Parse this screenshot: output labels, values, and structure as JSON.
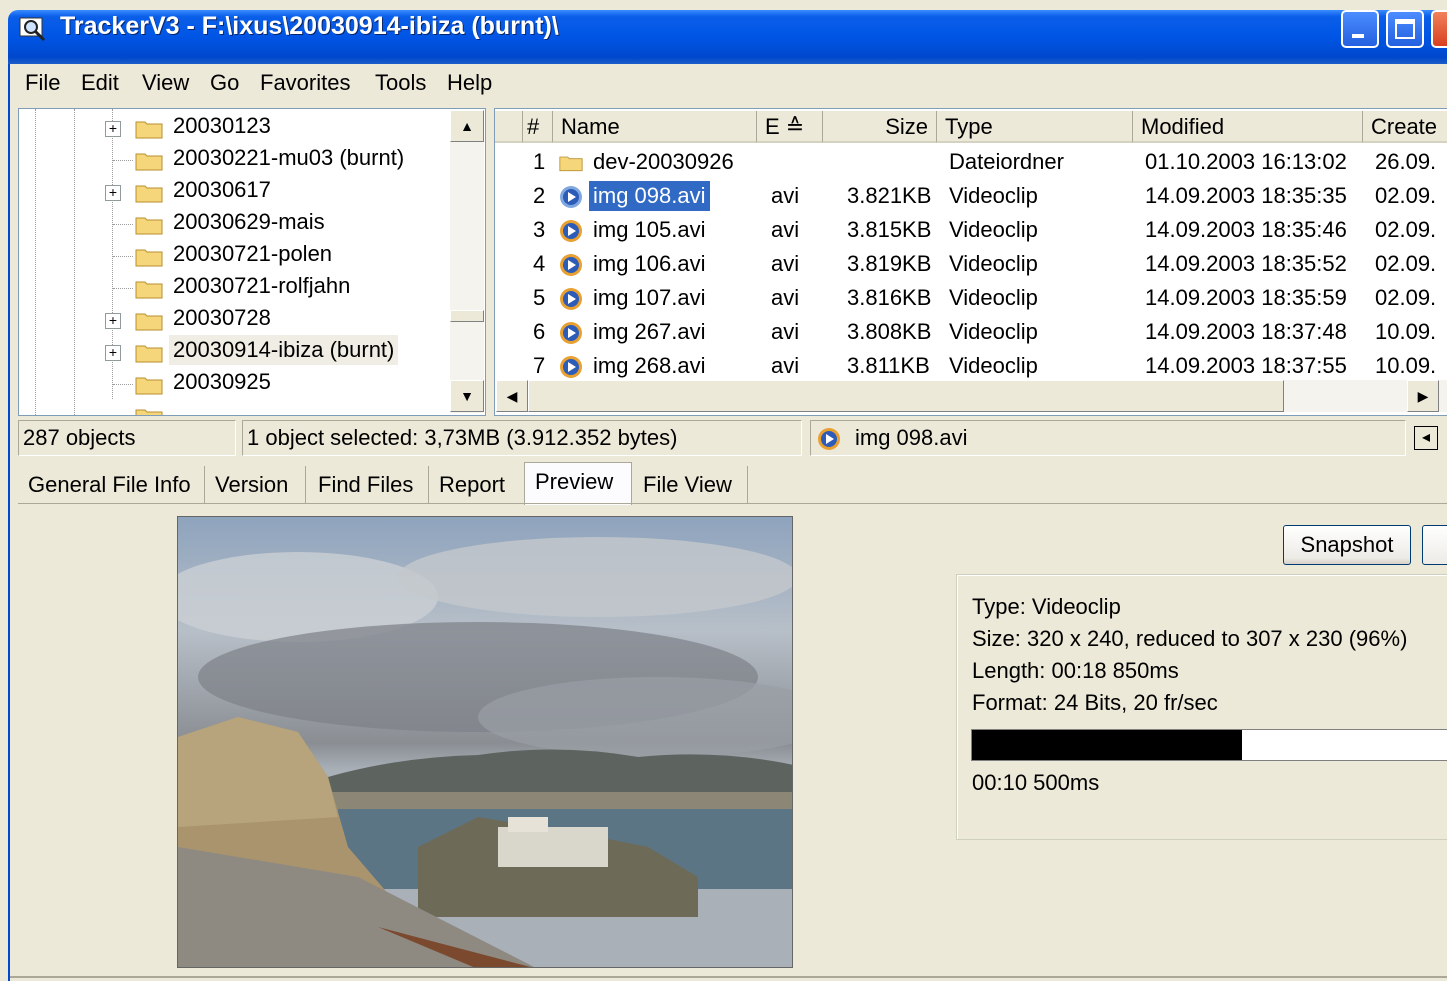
{
  "window": {
    "title": "TrackerV3 - F:\\ixus\\20030914-ibiza (burnt)\\",
    "app_icon": "magnifier-icon"
  },
  "menu": [
    "File",
    "Edit",
    "View",
    "Go",
    "Favorites",
    "Tools",
    "Help"
  ],
  "tree": {
    "items": [
      {
        "label": "20030123",
        "expandable": true
      },
      {
        "label": "20030221-mu03 (burnt)",
        "expandable": false
      },
      {
        "label": "20030617",
        "expandable": true
      },
      {
        "label": "20030629-mais",
        "expandable": false
      },
      {
        "label": "20030721-polen",
        "expandable": false
      },
      {
        "label": "20030721-rolfjahn",
        "expandable": false
      },
      {
        "label": "20030728",
        "expandable": true
      },
      {
        "label": "20030914-ibiza (burnt)",
        "expandable": true,
        "selected": true
      },
      {
        "label": "20030925",
        "expandable": false
      }
    ],
    "scroll_position": 0.74
  },
  "list": {
    "columns": [
      "#",
      "Name",
      "E ≙",
      "Size",
      "Type",
      "Modified",
      "Create"
    ],
    "rows": [
      {
        "num": "1",
        "name": "dev-20030926",
        "ext": "",
        "size": "",
        "type": "Dateiordner",
        "modified": "01.10.2003 16:13:02",
        "created": "26.09.",
        "icon": "folder-icon"
      },
      {
        "num": "2",
        "name": "img 098.avi",
        "ext": "avi",
        "size": "3.821KB",
        "type": "Videoclip",
        "modified": "14.09.2003 18:35:35",
        "created": "02.09.",
        "icon": "video-icon",
        "selected": true
      },
      {
        "num": "3",
        "name": "img 105.avi",
        "ext": "avi",
        "size": "3.815KB",
        "type": "Videoclip",
        "modified": "14.09.2003 18:35:46",
        "created": "02.09.",
        "icon": "video-icon"
      },
      {
        "num": "4",
        "name": "img 106.avi",
        "ext": "avi",
        "size": "3.819KB",
        "type": "Videoclip",
        "modified": "14.09.2003 18:35:52",
        "created": "02.09.",
        "icon": "video-icon"
      },
      {
        "num": "5",
        "name": "img 107.avi",
        "ext": "avi",
        "size": "3.816KB",
        "type": "Videoclip",
        "modified": "14.09.2003 18:35:59",
        "created": "02.09.",
        "icon": "video-icon"
      },
      {
        "num": "6",
        "name": "img 267.avi",
        "ext": "avi",
        "size": "3.808KB",
        "type": "Videoclip",
        "modified": "14.09.2003 18:37:48",
        "created": "10.09.",
        "icon": "video-icon"
      },
      {
        "num": "7",
        "name": "img 268.avi",
        "ext": "avi",
        "size": "3.811KB",
        "type": "Videoclip",
        "modified": "14.09.2003 18:37:55",
        "created": "10.09.",
        "icon": "video-icon"
      }
    ]
  },
  "status": {
    "objects": "287 objects",
    "selection": "1 object selected: 3,73MB (3.912.352 bytes)",
    "current_file": "img 098.avi"
  },
  "tabs": [
    "General File Info",
    "Version",
    "Find Files",
    "Report",
    "Preview",
    "File View"
  ],
  "active_tab": "Preview",
  "preview": {
    "snapshot_label": "Snapshot",
    "info": [
      "Type: Videoclip",
      "Size: 320 x 240, reduced to 307 x 230 (96%)",
      "Length: 00:18  850ms",
      "Format: 24 Bits, 20 fr/sec"
    ],
    "position_label": "00:10  500ms",
    "progress_fraction": 0.565
  },
  "colors": {
    "title_bar": "#0055E5",
    "selection": "#316AC5",
    "window_bg": "#ECE9D8"
  }
}
